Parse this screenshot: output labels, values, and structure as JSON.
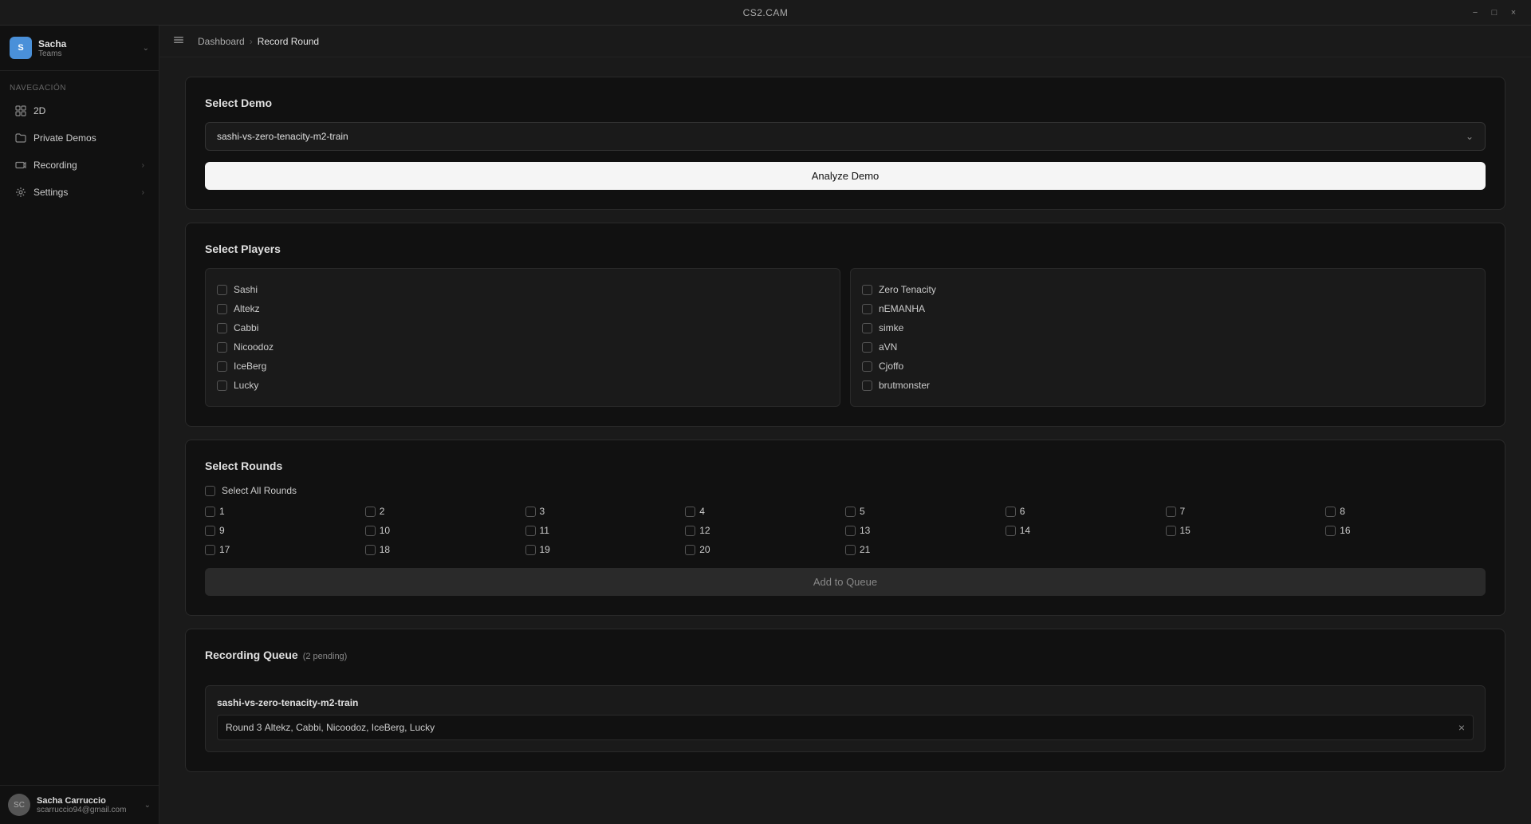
{
  "app": {
    "title": "CS2.CAM",
    "window_controls": {
      "minimize": "−",
      "maximize": "□",
      "close": "×"
    }
  },
  "sidebar": {
    "user": {
      "initials": "S",
      "name": "Sacha",
      "team": "Teams",
      "chevron": "⌃"
    },
    "nav_label": "Navegación",
    "items": [
      {
        "id": "2d",
        "label": "2D",
        "icon": "grid"
      },
      {
        "id": "private-demos",
        "label": "Private Demos",
        "icon": "folder"
      },
      {
        "id": "recording",
        "label": "Recording",
        "icon": "camera",
        "has_chevron": true
      },
      {
        "id": "settings",
        "label": "Settings",
        "icon": "gear",
        "has_chevron": true
      }
    ],
    "bottom_user": {
      "name": "Sacha Carruccio",
      "email": "scarruccio94@gmail.com",
      "initials": "SC"
    }
  },
  "topbar": {
    "breadcrumb": [
      {
        "label": "Dashboard",
        "active": false
      },
      {
        "label": "Record Round",
        "active": true
      }
    ]
  },
  "select_demo": {
    "title": "Select Demo",
    "selected_value": "sashi-vs-zero-tenacity-m2-train",
    "analyze_btn": "Analyze Demo"
  },
  "select_players": {
    "title": "Select Players",
    "team1": [
      {
        "name": "Sashi",
        "checked": false
      },
      {
        "name": "Altekz",
        "checked": false
      },
      {
        "name": "Cabbi",
        "checked": false
      },
      {
        "name": "Nicoodoz",
        "checked": false
      },
      {
        "name": "IceBerg",
        "checked": false
      },
      {
        "name": "Lucky",
        "checked": false
      }
    ],
    "team2": [
      {
        "name": "Zero Tenacity",
        "checked": false
      },
      {
        "name": "nEMANHA",
        "checked": false
      },
      {
        "name": "simke",
        "checked": false
      },
      {
        "name": "aVN",
        "checked": false
      },
      {
        "name": "Cjoffo",
        "checked": false
      },
      {
        "name": "brutmonster",
        "checked": false
      }
    ]
  },
  "select_rounds": {
    "title": "Select Rounds",
    "select_all_label": "Select All Rounds",
    "rounds": [
      1,
      2,
      3,
      4,
      5,
      6,
      7,
      8,
      9,
      10,
      11,
      12,
      13,
      14,
      15,
      16,
      17,
      18,
      19,
      20,
      21
    ],
    "add_queue_btn": "Add to Queue"
  },
  "recording_queue": {
    "title": "Recording Queue",
    "pending": "(2 pending)",
    "demo_name": "sashi-vs-zero-tenacity-m2-train",
    "round": {
      "label": "Round 3",
      "players": "Altekz, Cabbi, Nicoodoz, IceBerg, Lucky"
    }
  }
}
